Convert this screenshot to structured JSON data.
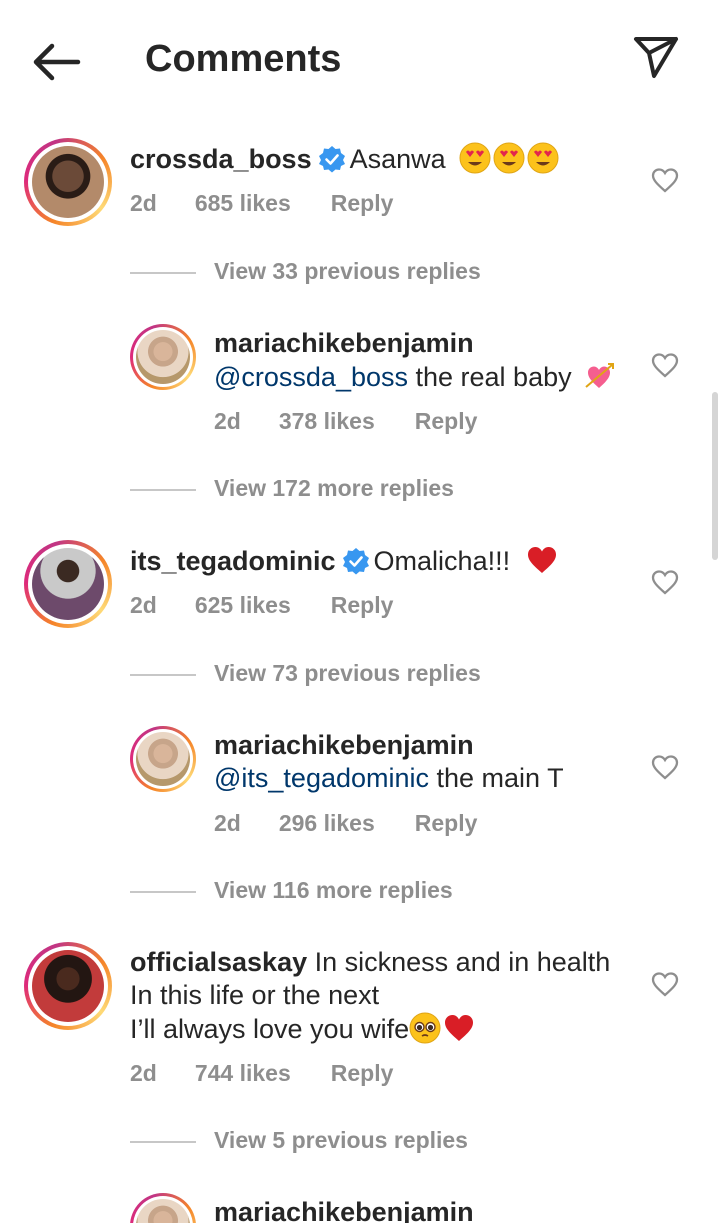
{
  "header": {
    "title": "Comments"
  },
  "comments": [
    {
      "username": "crossda_boss",
      "verified": true,
      "text": "Asanwa",
      "emoji": "heart-eyes-icon ×3",
      "time": "2d",
      "likes": "685 likes",
      "reply": "Reply",
      "view_replies": "View 33 previous replies",
      "reply_item": {
        "username": "mariachikebenjamin",
        "mention": "@crossda_boss",
        "text": " the real baby",
        "emoji": "heart-with-arrow-icon",
        "time": "2d",
        "likes": "378 likes",
        "reply": "Reply"
      },
      "more_replies": "View 172 more replies"
    },
    {
      "username": "its_tegadominic",
      "verified": true,
      "text": "Omalicha!!!",
      "emoji": "red-heart-icon",
      "time": "2d",
      "likes": "625 likes",
      "reply": "Reply",
      "view_replies": "View 73 previous replies",
      "reply_item": {
        "username": "mariachikebenjamin",
        "mention": "@its_tegadominic",
        "text": " the main T",
        "time": "2d",
        "likes": "296 likes",
        "reply": "Reply"
      },
      "more_replies": "View 116 more replies"
    },
    {
      "username": "officialsaskay",
      "verified": false,
      "text_line1": "In sickness and in health",
      "text_line2": "In this life or the next",
      "text_line3": "I’ll always love you wife",
      "emoji": "pleading-face-icon red-heart-icon",
      "time": "2d",
      "likes": "744 likes",
      "reply": "Reply",
      "view_replies": "View 5 previous replies",
      "reply_item": {
        "username": "mariachikebenjamin"
      }
    }
  ],
  "colors": {
    "text": "#262626",
    "muted": "#8e8e8e",
    "mention": "#00376b",
    "verified": "#3897f0",
    "heart_red": "#ed1c24"
  }
}
